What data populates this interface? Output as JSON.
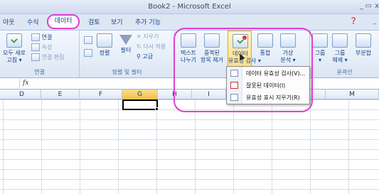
{
  "window": {
    "title": "Book2 - Microsoft Excel",
    "controls": {
      "min": "_",
      "max": "▭",
      "close": "x"
    }
  },
  "tabs": [
    {
      "label": "아웃"
    },
    {
      "label": "수식"
    },
    {
      "label": "데이터",
      "selected": true
    },
    {
      "label": "검토"
    },
    {
      "label": "보기"
    },
    {
      "label": "추가 기능"
    }
  ],
  "tab_controls": {
    "help": "❓",
    "min": "_",
    "max": "▭"
  },
  "ribbon": {
    "connections": {
      "refresh_all": "모두 새로\n고침 ▾",
      "connections": "연결",
      "properties": "속성",
      "edit_links": "연결 편집",
      "label": "연결"
    },
    "sort_filter": {
      "sort": "정렬",
      "filter": "필터",
      "clear": "지우기",
      "reapply": "다시 적용",
      "advanced": "고급",
      "label": "정렬 및 필터"
    },
    "data_tools": {
      "text_to_columns": "텍스트\n나누기",
      "remove_duplicates": "중복된\n항목 제거",
      "data_validation": "데이터\n유효성 검사 ▾",
      "consolidate": "통합",
      "what_if": "가상\n분석 ▾"
    },
    "outline": {
      "group": "그룹\n▾",
      "ungroup": "그룹\n해제 ▾",
      "subtotal": "부분합",
      "label": "윤곽선"
    }
  },
  "formula_bar": {
    "fx": "fx",
    "value": ""
  },
  "columns": [
    "D",
    "E",
    "F",
    "G",
    "H",
    "I",
    "",
    "",
    "M"
  ],
  "selected_column": "G",
  "menu": {
    "items": [
      {
        "label": "데이터 유효성 검사(V)...",
        "icon": "data-validation-icon"
      },
      {
        "label": "잘못된 데이터(I)",
        "icon": "circle-invalid-icon"
      },
      {
        "label": "유효성 표시 지우기(R)",
        "icon": "clear-circles-icon"
      }
    ]
  },
  "colors": {
    "annotation": "#e23fd1",
    "ribbon_text": "#15428b",
    "active_button": "#ffd873"
  }
}
